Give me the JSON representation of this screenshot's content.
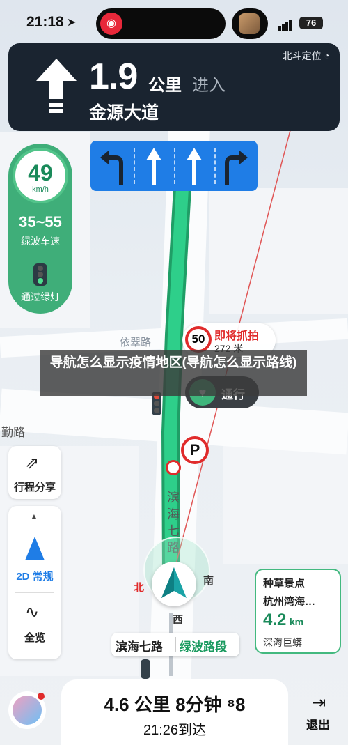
{
  "status_bar": {
    "time": "21:18",
    "battery": "76",
    "island_icon": "netease-music-icon"
  },
  "nav_card": {
    "positioning": "北斗定位",
    "distance": "1.9",
    "unit": "公里",
    "action": "进入",
    "road": "金源大道"
  },
  "lanes": [
    "turn-left-icon",
    "straight-icon",
    "straight-icon",
    "turn-right-icon"
  ],
  "speed_panel": {
    "current_speed": "49",
    "speed_unit": "km/h",
    "green_wave_range": "35~55",
    "green_wave_label": "绿波车速",
    "green_light_label": "通过绿灯"
  },
  "map_labels": {
    "yicui": "依翠路",
    "qin": "勤路",
    "binhai_vertical": [
      "滨",
      "海",
      "七",
      "路"
    ]
  },
  "camera": {
    "speed_limit": "50",
    "title": "即将抓拍",
    "distance": "272 米"
  },
  "overlay": {
    "title": "导航怎么显示疫情地区(导航怎么显示路线)"
  },
  "pass_button": {
    "label": "通行"
  },
  "side_buttons": {
    "trip_share": "行程分享",
    "view_mode": "2D 常规",
    "overview": "全览"
  },
  "compass": {
    "north": "北",
    "south": "南",
    "west": "西"
  },
  "destination": {
    "line1": "种草景点",
    "line2": "杭州湾海…",
    "distance": "4.2",
    "unit": "km",
    "line3": "深海巨蟒"
  },
  "road_bar": {
    "current": "滨海七路",
    "section": "绿波路段"
  },
  "bottom": {
    "summary": "4.6 公里 8分钟 ⁸8",
    "arrival": "21:26到达",
    "exit": "退出"
  },
  "colors": {
    "nav_bg": "#1a2430",
    "lane_blue": "#1f7de6",
    "route_green": "#2ecf8a",
    "camera_red": "#e02b2b"
  }
}
